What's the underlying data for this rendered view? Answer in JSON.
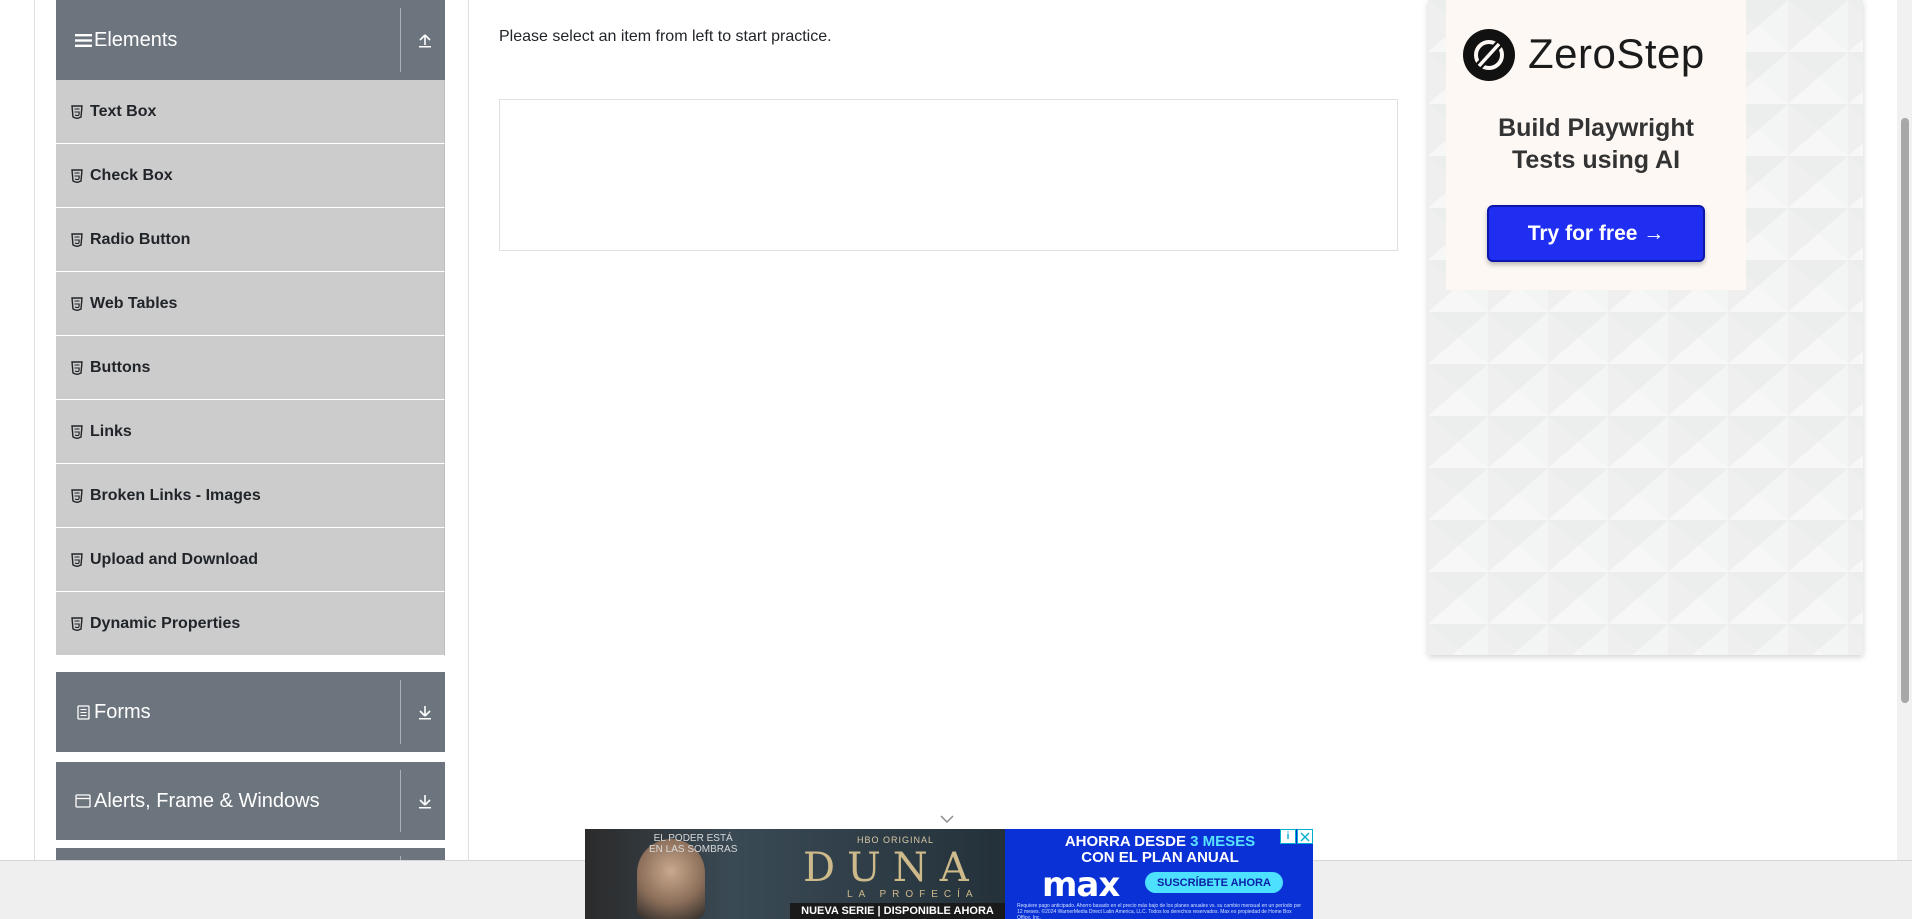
{
  "sidebar": {
    "groups": [
      {
        "title": "Elements",
        "icon": "hamburger-icon",
        "toggle_icon": "collapse-up-icon"
      },
      {
        "title": "Forms",
        "icon": "form-icon",
        "toggle_icon": "expand-down-icon"
      },
      {
        "title": "Alerts, Frame & Windows",
        "icon": "window-icon",
        "toggle_icon": "expand-down-icon"
      }
    ],
    "items": [
      {
        "label": "Text Box",
        "icon": "html5-icon"
      },
      {
        "label": "Check Box",
        "icon": "html5-icon"
      },
      {
        "label": "Radio Button",
        "icon": "html5-icon"
      },
      {
        "label": "Web Tables",
        "icon": "html5-icon"
      },
      {
        "label": "Buttons",
        "icon": "html5-icon"
      },
      {
        "label": "Links",
        "icon": "html5-icon"
      },
      {
        "label": "Broken Links - Images",
        "icon": "html5-icon"
      },
      {
        "label": "Upload and Download",
        "icon": "html5-icon"
      },
      {
        "label": "Dynamic Properties",
        "icon": "html5-icon"
      }
    ]
  },
  "main": {
    "instruction": "Please select an item from left to start practice."
  },
  "ad": {
    "brand": "ZeroStep",
    "headline": "Build Playwright\nTests using AI",
    "cta": "Try for free →",
    "cta_color": "#1f2ef0"
  },
  "banner": {
    "tagline": "EL PODER ESTÁ\nEN LAS SOMBRAS",
    "original": "HBO ORIGINAL",
    "title": "DUNA",
    "subtitle": "LA PROFECÍA",
    "footer": "NUEVA SERIE | DISPONIBLE AHORA",
    "offer_prefix": "AHORRA DESDE ",
    "offer_highlight": "3 MESES",
    "offer_suffix": "CON EL PLAN ANUAL",
    "brand": "max",
    "subscribe": "SUSCRÍBETE AHORA",
    "legal": "Requiere pago anticipado. Ahorro basado en el precio más bajo de los planes anuales vs. su cambio mensual en un período por 12 meses. ©2024 WarnerMedia Direct Latin America, LLC. Todos los derechos reservados. Max es propiedad de Home Box Office, Inc."
  },
  "colors": {
    "group_header": "#6c757d",
    "menu_item": "#cccccc",
    "banner_blue": "#0a31d6"
  }
}
